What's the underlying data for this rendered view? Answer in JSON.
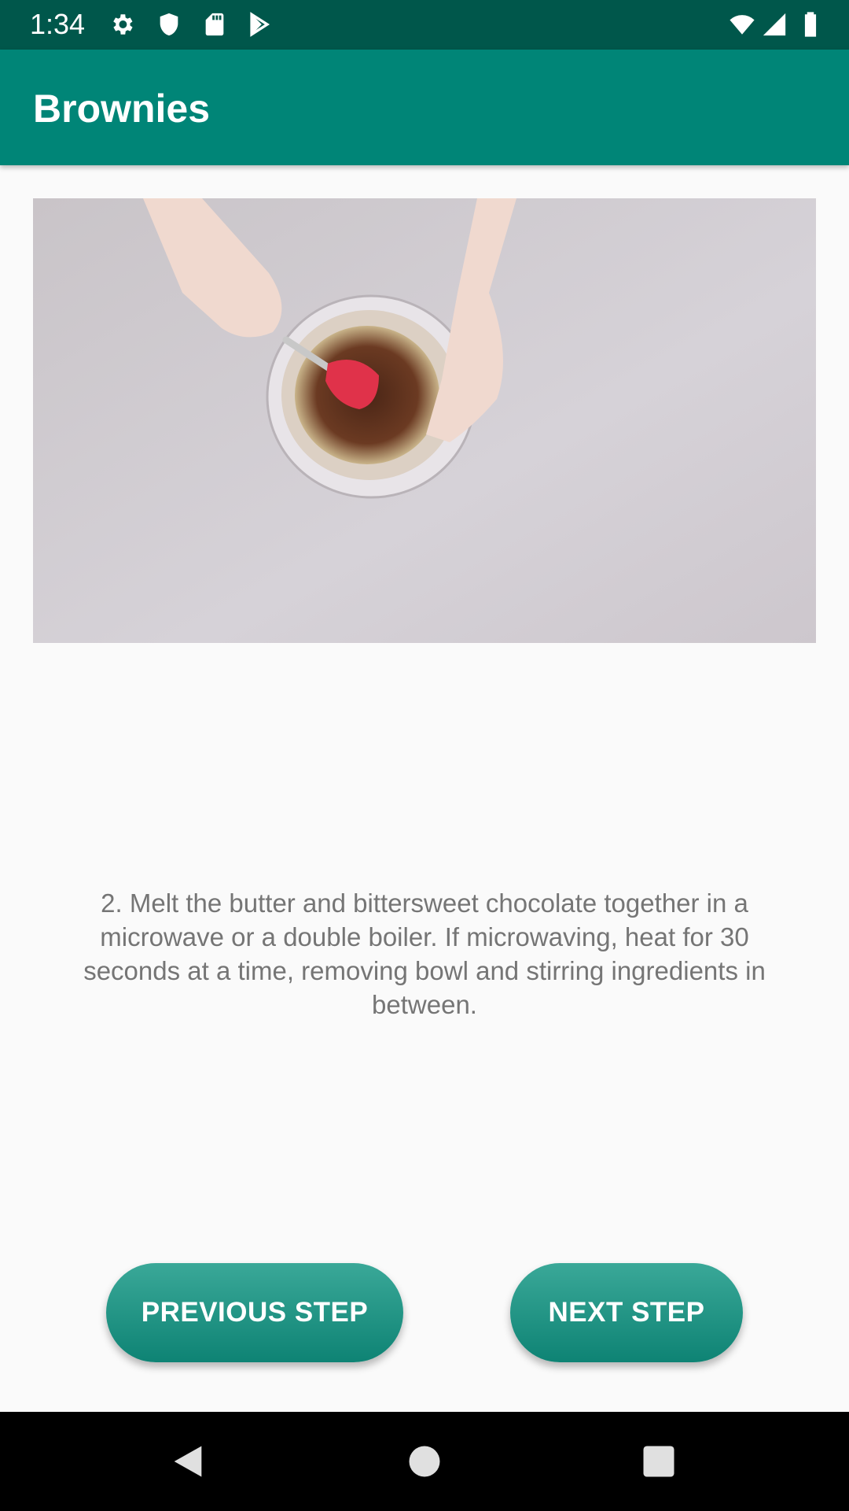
{
  "status_bar": {
    "time": "1:34",
    "left_icons": [
      "settings-icon",
      "shield-icon",
      "sd-card-icon",
      "play-store-icon"
    ],
    "right_icons": [
      "wifi-icon",
      "signal-icon",
      "battery-icon"
    ]
  },
  "app_bar": {
    "title": "Brownies"
  },
  "step": {
    "description": "2. Melt the butter and bittersweet chocolate together in a microwave or a double boiler. If microwaving, heat for 30 seconds at a time, removing bowl and stirring ingredients in between."
  },
  "buttons": {
    "previous_label": "PREVIOUS STEP",
    "next_label": "NEXT STEP"
  },
  "nav_bar": {
    "icons": [
      "back-icon",
      "home-icon",
      "recents-icon"
    ]
  },
  "colors": {
    "status_bar": "#00574b",
    "app_bar": "#008577",
    "button": "#1a8f80",
    "text_muted": "#757575"
  }
}
